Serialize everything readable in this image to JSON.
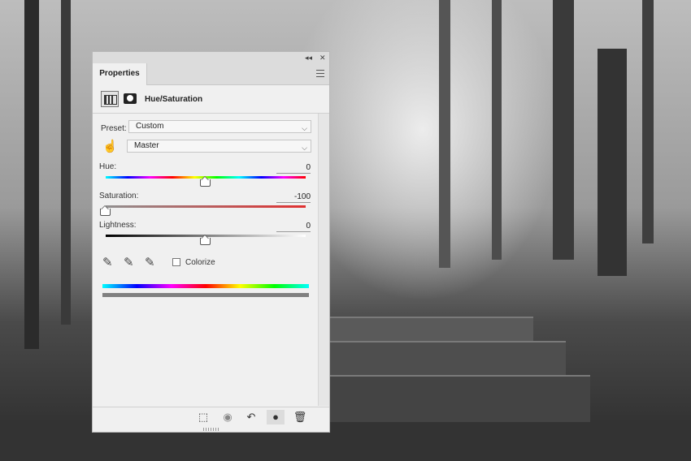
{
  "panel": {
    "collapse_glyph": "◂◂",
    "close_glyph": "✕",
    "tab_label": "Properties",
    "menu_icon": "hamburger-menu-icon",
    "adjustment_title": "Hue/Saturation"
  },
  "preset": {
    "label": "Preset:",
    "value": "Custom"
  },
  "channel": {
    "value": "Master"
  },
  "hue": {
    "label": "Hue:",
    "value": "0",
    "level": 0.5
  },
  "saturation": {
    "label": "Saturation:",
    "value": "-100",
    "level": 0.0
  },
  "lightness": {
    "label": "Lightness:",
    "value": "0",
    "level": 0.5
  },
  "colorize": {
    "label": "Colorize",
    "checked": false
  },
  "icons": {
    "hand": "☝",
    "eyedropper": "✎",
    "eyedropper_plus": "✎",
    "eyedropper_minus": "✎",
    "clip": "⬚",
    "view_prev": "◉",
    "reset": "↶",
    "visibility": "●",
    "trash": "🗑"
  },
  "colors": {
    "panel_bg": "#f0f0f0",
    "output_bar": "#808080"
  }
}
